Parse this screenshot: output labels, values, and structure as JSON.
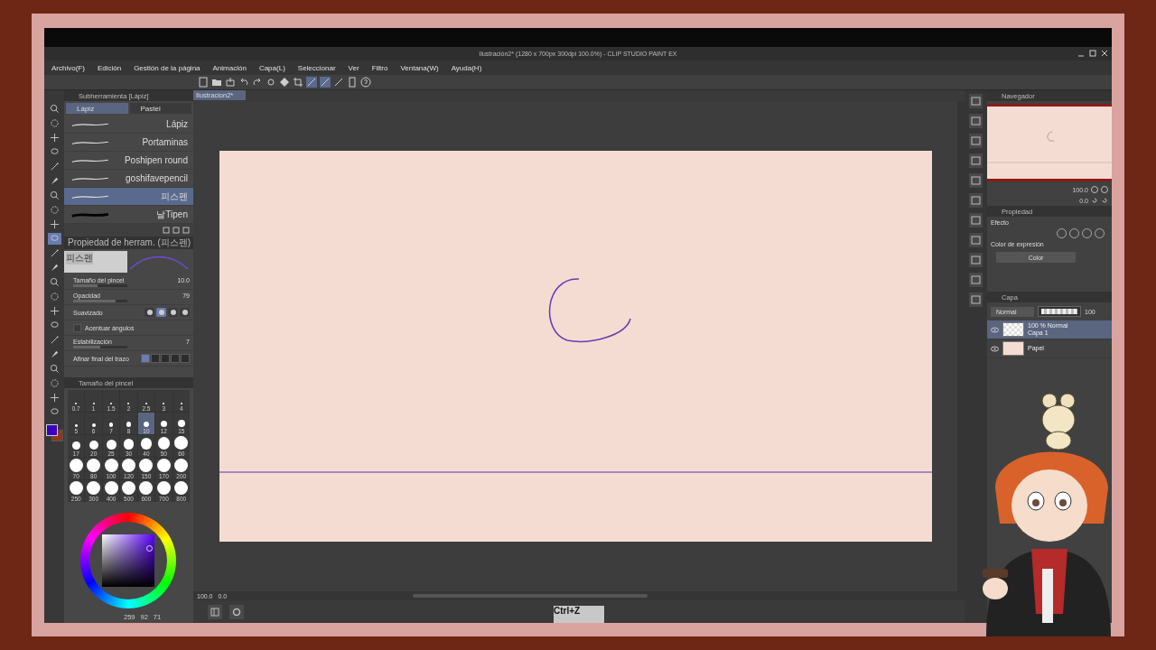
{
  "window": {
    "title": "Ilustración2* (1280 x 700px 300dpi 100.0%) - CLIP STUDIO PAINT EX"
  },
  "menu": [
    "Archivo(F)",
    "Edición",
    "Gestión de la página",
    "Animación",
    "Capa(L)",
    "Seleccionar",
    "Ver",
    "Filtro",
    "Ventana(W)",
    "Ayuda(H)"
  ],
  "tools": [
    {
      "selected": false
    },
    {
      "selected": false
    },
    {
      "selected": false
    },
    {
      "selected": false
    },
    {
      "selected": false
    },
    {
      "selected": false
    },
    {
      "selected": false
    },
    {
      "selected": false
    },
    {
      "selected": false
    },
    {
      "selected": true
    },
    {
      "selected": false
    },
    {
      "selected": false
    },
    {
      "selected": false
    },
    {
      "selected": false
    },
    {
      "selected": false
    },
    {
      "selected": false
    },
    {
      "selected": false
    },
    {
      "selected": false
    },
    {
      "selected": false
    },
    {
      "selected": false
    },
    {
      "selected": false
    },
    {
      "selected": false
    }
  ],
  "document_tab": {
    "label": "Ilustracion2*"
  },
  "subtool_panel": {
    "title": "Subherramienta [Lápiz]",
    "tabs": [
      {
        "label": "Lápiz",
        "selected": true
      },
      {
        "label": "Pastel",
        "selected": false
      }
    ],
    "brushes": [
      {
        "name": "Lápiz",
        "selected": false
      },
      {
        "name": "Portaminas",
        "selected": false
      },
      {
        "name": "Poshipen round",
        "selected": false
      },
      {
        "name": "goshifavepencil",
        "selected": false
      },
      {
        "name": "피스펜",
        "selected": true
      },
      {
        "name": "날Tipen",
        "selected": false
      }
    ]
  },
  "tool_property": {
    "title": "Propiedad de herram. (피스펜)",
    "preview_label": "피스펜",
    "rows": [
      {
        "kind": "slider",
        "label": "Tamaño del pincel",
        "value": "10.0",
        "level": 0.45
      },
      {
        "kind": "slider",
        "label": "Opacidad",
        "value": "79",
        "level": 0.79
      },
      {
        "kind": "shapes",
        "label": "Suavizado",
        "options": [
          {
            "selected": false
          },
          {
            "selected": true
          },
          {
            "selected": false
          },
          {
            "selected": false
          }
        ]
      },
      {
        "kind": "checkbox",
        "label": "Acentuar ángulos",
        "checked": false
      },
      {
        "kind": "slider",
        "label": "Estabilización",
        "value": "7",
        "level": 0.5
      },
      {
        "kind": "steps",
        "label": "Afinar final del trazo",
        "options": [
          {
            "selected": true
          },
          {
            "selected": false
          },
          {
            "selected": false
          },
          {
            "selected": false
          },
          {
            "selected": false
          }
        ]
      }
    ]
  },
  "brush_size_panel": {
    "title": "Tamaño del pincel",
    "sizes": [
      {
        "label": "0.7",
        "selected": false
      },
      {
        "label": "1",
        "selected": false
      },
      {
        "label": "1.5",
        "selected": false
      },
      {
        "label": "2",
        "selected": false
      },
      {
        "label": "2.5",
        "selected": false
      },
      {
        "label": "3",
        "selected": false
      },
      {
        "label": "4",
        "selected": false
      },
      {
        "label": "5",
        "selected": false
      },
      {
        "label": "6",
        "selected": false
      },
      {
        "label": "7",
        "selected": false
      },
      {
        "label": "8",
        "selected": false
      },
      {
        "label": "10",
        "selected": true
      },
      {
        "label": "12",
        "selected": false
      },
      {
        "label": "15",
        "selected": false
      },
      {
        "label": "17",
        "selected": false
      },
      {
        "label": "20",
        "selected": false
      },
      {
        "label": "25",
        "selected": false
      },
      {
        "label": "30",
        "selected": false
      },
      {
        "label": "40",
        "selected": false
      },
      {
        "label": "50",
        "selected": false
      },
      {
        "label": "60",
        "selected": false
      },
      {
        "label": "70",
        "selected": false
      },
      {
        "label": "80",
        "selected": false
      },
      {
        "label": "100",
        "selected": false
      },
      {
        "label": "120",
        "selected": false
      },
      {
        "label": "150",
        "selected": false
      },
      {
        "label": "170",
        "selected": false
      },
      {
        "label": "200",
        "selected": false
      },
      {
        "label": "250",
        "selected": false
      },
      {
        "label": "300",
        "selected": false
      },
      {
        "label": "400",
        "selected": false
      },
      {
        "label": "500",
        "selected": false
      },
      {
        "label": "600",
        "selected": false
      },
      {
        "label": "700",
        "selected": false
      },
      {
        "label": "800",
        "selected": false
      }
    ]
  },
  "color": {
    "swatches": [
      {
        "kind": "main",
        "color": "#3a00c0"
      },
      {
        "kind": "sub",
        "color": "#8b3a1c"
      }
    ],
    "readouts": [
      "259",
      "92",
      "71"
    ]
  },
  "navigator": {
    "title": "Navegador",
    "zoom": "100.0",
    "angle": "0.0"
  },
  "properties_panel": {
    "title": "Propiedad",
    "effect_label": "Efecto",
    "expression_label": "Color de expresión",
    "expression_value": "Color"
  },
  "layers_panel": {
    "title": "Capa",
    "blend_mode": "Normal",
    "opacity": "100",
    "opacity_slider": {
      "level": 1
    },
    "layers": [
      {
        "info": "100 % Normal",
        "name": "Capa 1",
        "selected": true
      },
      {
        "name": "Papel",
        "selected": false
      }
    ]
  },
  "canvas_status": {
    "zoom": "100.0",
    "angle": "0.0"
  },
  "key_overlay": "Ctrl+Z"
}
